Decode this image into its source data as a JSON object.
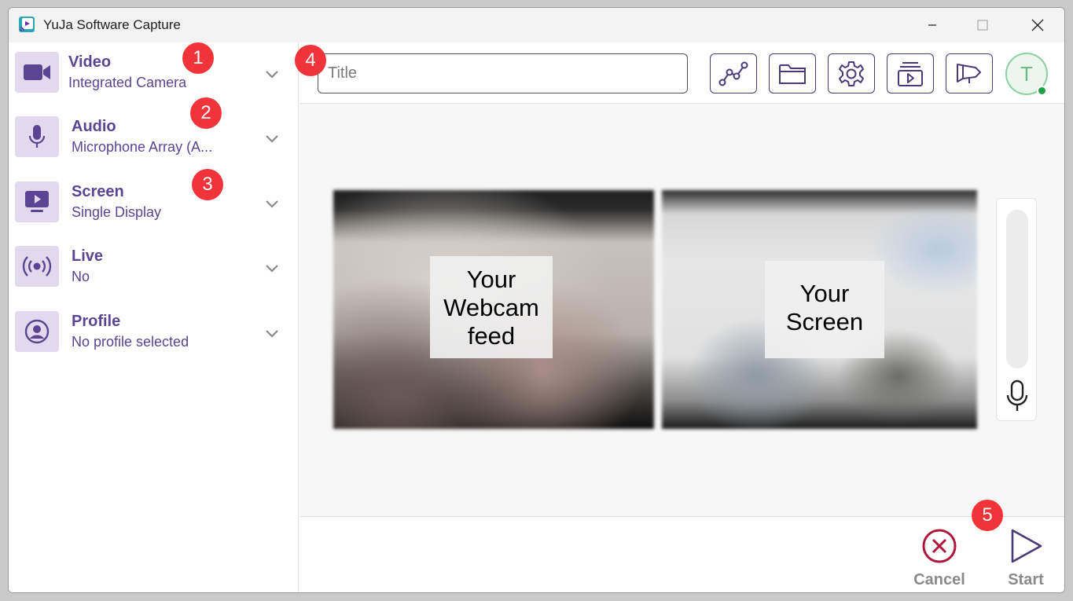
{
  "window": {
    "title": "YuJa Software Capture"
  },
  "sidebar": {
    "items": [
      {
        "title": "Video",
        "subtitle": "Integrated Camera"
      },
      {
        "title": "Audio",
        "subtitle": "Microphone Array (A..."
      },
      {
        "title": "Screen",
        "subtitle": "Single Display"
      },
      {
        "title": "Live",
        "subtitle": "No"
      },
      {
        "title": "Profile",
        "subtitle": "No profile selected"
      }
    ]
  },
  "header": {
    "title_placeholder": "Title",
    "avatar_initial": "T"
  },
  "preview": {
    "webcam_label": "Your Webcam feed",
    "screen_label": "Your Screen"
  },
  "footer": {
    "cancel_label": "Cancel",
    "start_label": "Start"
  },
  "badges": [
    "1",
    "2",
    "3",
    "4",
    "5"
  ],
  "colors": {
    "accent": "#5b4592",
    "icon_bg": "#e3d9ef",
    "badge": "#f0343a",
    "cancel": "#b0173e",
    "online": "#1e9e45"
  }
}
